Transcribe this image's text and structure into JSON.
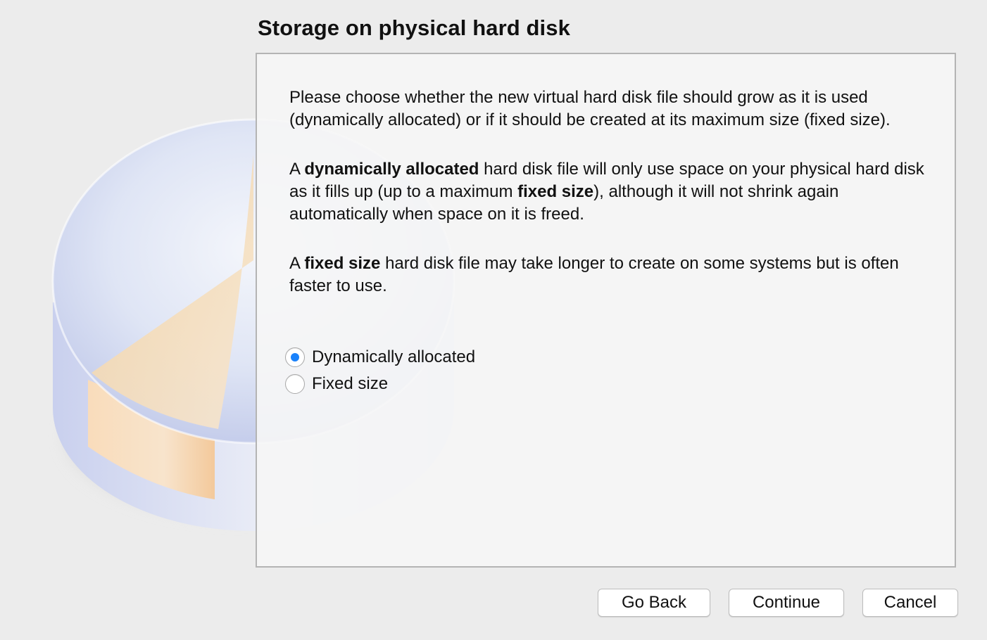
{
  "page": {
    "title": "Storage on physical hard disk"
  },
  "description": {
    "paragraph1": "Please choose whether the new virtual hard disk file should grow as it is used (dynamically allocated) or if it should be created at its maximum size (fixed size).",
    "paragraph2": {
      "part1": "A ",
      "bold1": "dynamically allocated",
      "part2": " hard disk file will only use space on your physical hard disk as it fills up (up to a maximum ",
      "bold2": "fixed size",
      "part3": "), although it will not shrink again automatically when space on it is freed."
    },
    "paragraph3": {
      "part1": "A ",
      "bold1": "fixed size",
      "part2": " hard disk file may take longer to create on some systems but is often faster to use."
    }
  },
  "storage_options": {
    "selected": "dynamic",
    "dynamic_label": "Dynamically allocated",
    "fixed_label": "Fixed size"
  },
  "buttons": {
    "go_back": "Go Back",
    "continue": "Continue",
    "cancel": "Cancel"
  },
  "colors": {
    "accent": "#1a82fb",
    "window_background": "#ececec",
    "panel_border": "#b4b4b4"
  },
  "icons": {
    "illustration": "hard-disk-pie-illustration",
    "radio_checked": "radio-selected-dot"
  }
}
